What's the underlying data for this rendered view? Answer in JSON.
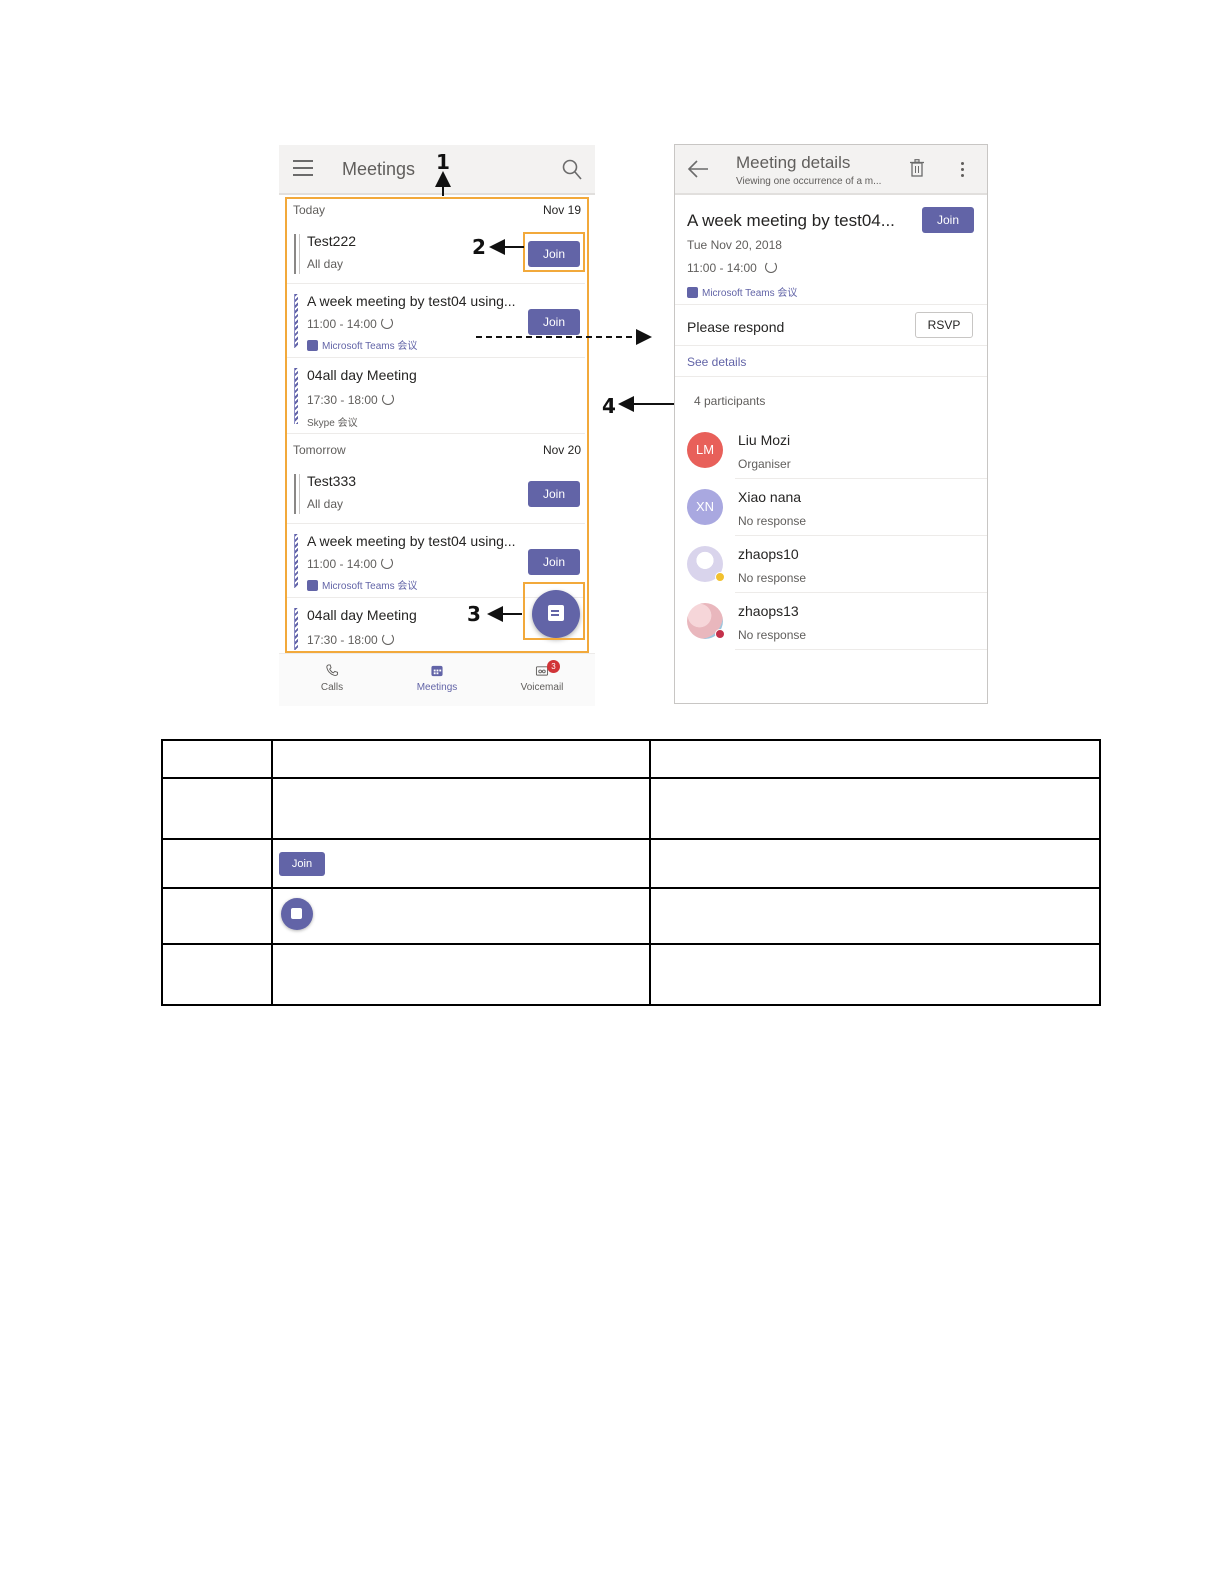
{
  "left": {
    "title": "Meetings",
    "sections": [
      {
        "label": "Today",
        "date": "Nov 19",
        "items": [
          {
            "title": "Test222",
            "line2": "All day",
            "line3": "",
            "join": "Join"
          },
          {
            "title": "A week meeting by test04 using...",
            "line2": "11:00 - 14:00",
            "line3": "Microsoft Teams 会议",
            "join": "Join"
          },
          {
            "title": "04all day Meeting",
            "line2": "17:30 - 18:00",
            "line3": "Skype 会议",
            "join": ""
          }
        ]
      },
      {
        "label": "Tomorrow",
        "date": "Nov 20",
        "items": [
          {
            "title": "Test333",
            "line2": "All day",
            "line3": "",
            "join": "Join"
          },
          {
            "title": "A week meeting by test04 using...",
            "line2": "11:00 - 14:00",
            "line3": "Microsoft Teams 会议",
            "join": "Join"
          },
          {
            "title": "04all day Meeting",
            "line2": "17:30 - 18:00",
            "line3": "",
            "join": ""
          }
        ]
      }
    ],
    "nav": {
      "calls": "Calls",
      "meetings": "Meetings",
      "voicemail": "Voicemail",
      "voicemail_badge": "3"
    }
  },
  "callouts": {
    "c1": "1",
    "c2": "2",
    "c3": "3",
    "c4": "4"
  },
  "right": {
    "title": "Meeting details",
    "subtitle": "Viewing one occurrence of a m...",
    "meeting_title": "A week meeting by test04...",
    "join": "Join",
    "date": "Tue Nov 20, 2018",
    "time": "11:00 - 14:00",
    "source": "Microsoft Teams 会议",
    "respond": "Please respond",
    "rsvp": "RSVP",
    "see_details": "See details",
    "participants_count": "4 participants",
    "participants": [
      {
        "initials": "LM",
        "name": "Liu Mozi",
        "status": "Organiser",
        "color": "#e8605a"
      },
      {
        "initials": "XN",
        "name": "Xiao nana",
        "status": "No response",
        "color": "#a9a8e0"
      },
      {
        "initials": "",
        "name": "zhaops10",
        "status": "No response",
        "color": "#d9d4ec"
      },
      {
        "initials": "",
        "name": "zhaops13",
        "status": "No response",
        "color": "#e9b7bd"
      }
    ]
  },
  "table": {
    "row2_button": "Join"
  },
  "colors": {
    "accent": "#6264a7",
    "callout_box": "#f2a93b"
  }
}
